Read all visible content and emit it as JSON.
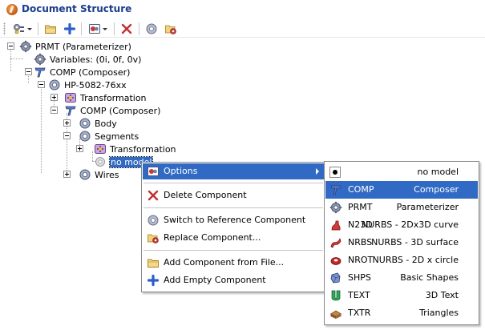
{
  "window": {
    "title": "Document Structure"
  },
  "toolbar": {
    "buttons": [
      {
        "name": "model-tree-icon",
        "has_dropdown": true
      },
      {
        "name": "open-folder-icon",
        "has_dropdown": false
      },
      {
        "name": "add-icon",
        "has_dropdown": false
      },
      {
        "name": "options-icon",
        "has_dropdown": true
      },
      {
        "name": "delete-icon",
        "has_dropdown": false
      },
      {
        "name": "reference-icon",
        "has_dropdown": false
      },
      {
        "name": "replace-icon",
        "has_dropdown": false
      }
    ]
  },
  "tree": {
    "nodes": [
      {
        "label": "PRMT (Parameterizer)",
        "icon": "parameterizer-icon"
      },
      {
        "label": "Variables: (0i, 0f, 0v)",
        "icon": "variables-icon"
      },
      {
        "label": "COMP (Composer)",
        "icon": "composer-icon"
      },
      {
        "label": "HP-5082-76xx",
        "icon": "component-icon"
      },
      {
        "label": "Transformation",
        "icon": "transformation-icon"
      },
      {
        "label": "COMP (Composer)",
        "icon": "composer-icon"
      },
      {
        "label": "Body",
        "icon": "component-icon"
      },
      {
        "label": "Segments",
        "icon": "component-icon"
      },
      {
        "label": "Transformation",
        "icon": "transformation-icon"
      },
      {
        "label": "no model",
        "icon": "no-model-icon"
      },
      {
        "label": "Wires",
        "icon": "component-icon"
      }
    ]
  },
  "context_menu": {
    "items": [
      {
        "label": "Options",
        "icon": "options-icon"
      },
      {
        "label": "Delete Component",
        "icon": "delete-icon"
      },
      {
        "label": "Switch to Reference Component",
        "icon": "reference-icon"
      },
      {
        "label": "Replace Component...",
        "icon": "replace-icon"
      },
      {
        "label": "Add Component from File...",
        "icon": "folder-icon"
      },
      {
        "label": "Add Empty Component",
        "icon": "add-icon"
      }
    ]
  },
  "submenu": {
    "items": [
      {
        "code": "",
        "desc": "no model",
        "icon": "radio-selected-icon"
      },
      {
        "code": "COMP",
        "desc": "Composer",
        "icon": "composer-icon"
      },
      {
        "code": "PRMT",
        "desc": "Parameterizer",
        "icon": "parameterizer-icon"
      },
      {
        "code": "N23D",
        "desc": "NURBS - 2Dx3D curve",
        "icon": "nurbs-curve-icon"
      },
      {
        "code": "NRBS",
        "desc": "NURBS - 3D surface",
        "icon": "nurbs-surface-icon"
      },
      {
        "code": "NROT",
        "desc": "NURBS - 2D x circle",
        "icon": "nurbs-rotation-icon"
      },
      {
        "code": "SHPS",
        "desc": "Basic Shapes",
        "icon": "basic-shapes-icon"
      },
      {
        "code": "TEXT",
        "desc": "3D Text",
        "icon": "text-3d-icon"
      },
      {
        "code": "TXTR",
        "desc": "Triangles",
        "icon": "triangles-icon"
      }
    ]
  },
  "colors": {
    "selection": "#316ac5",
    "title": "#1a3c8c"
  }
}
